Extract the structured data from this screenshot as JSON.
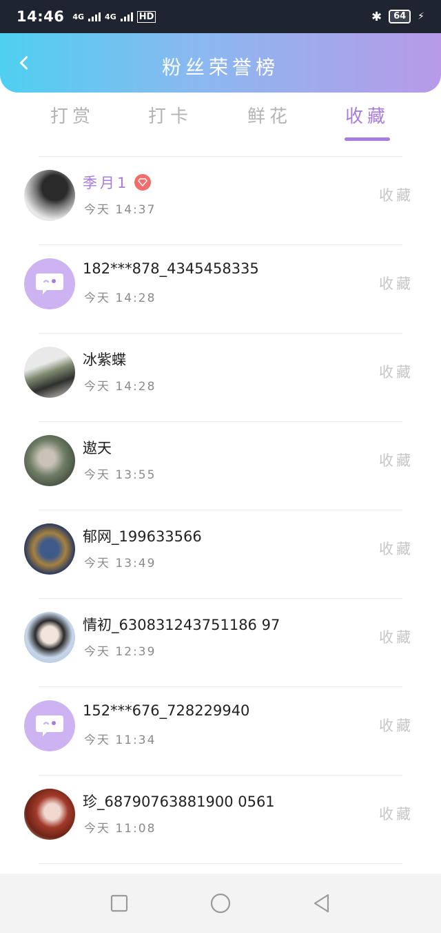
{
  "status_bar": {
    "time": "14:46",
    "network_1": "4G",
    "network_2": "4G",
    "hd_label": "HD",
    "battery": "64"
  },
  "header": {
    "title": "粉丝荣誉榜",
    "back_icon": "chevron-left-icon"
  },
  "tabs": [
    {
      "label": "打赏",
      "active": false
    },
    {
      "label": "打卡",
      "active": false
    },
    {
      "label": "鲜花",
      "active": false
    },
    {
      "label": "收藏",
      "active": true
    }
  ],
  "accent_color": "#a77ce0",
  "rows": [
    {
      "name": "季月1",
      "time": "今天 14:37",
      "action": "收藏",
      "avatar": "photo-dark-hair",
      "vip": true
    },
    {
      "name": "182***878_4345458335",
      "time": "今天 14:28",
      "action": "收藏",
      "avatar": "default-chat-icon",
      "vip": false
    },
    {
      "name": "冰紫蝶",
      "time": "今天 14:28",
      "action": "收藏",
      "avatar": "photo-outdoor",
      "vip": false
    },
    {
      "name": "遨天",
      "time": "今天 13:55",
      "action": "收藏",
      "avatar": "photo-forest",
      "vip": false
    },
    {
      "name": "郁网_199633566",
      "time": "今天 13:49",
      "action": "收藏",
      "avatar": "photo-planet",
      "vip": false
    },
    {
      "name": "情初_630831243751186 97",
      "time": "今天 12:39",
      "action": "收藏",
      "avatar": "photo-anime",
      "vip": false
    },
    {
      "name": "152***676_728229940",
      "time": "今天 11:34",
      "action": "收藏",
      "avatar": "default-chat-icon",
      "vip": false
    },
    {
      "name": "珍_68790763881900 0561",
      "time": "今天 11:08",
      "action": "收藏",
      "avatar": "photo-red-hair",
      "vip": false
    }
  ],
  "nav": {
    "recent": "square-icon",
    "home": "circle-icon",
    "back": "triangle-back-icon"
  }
}
